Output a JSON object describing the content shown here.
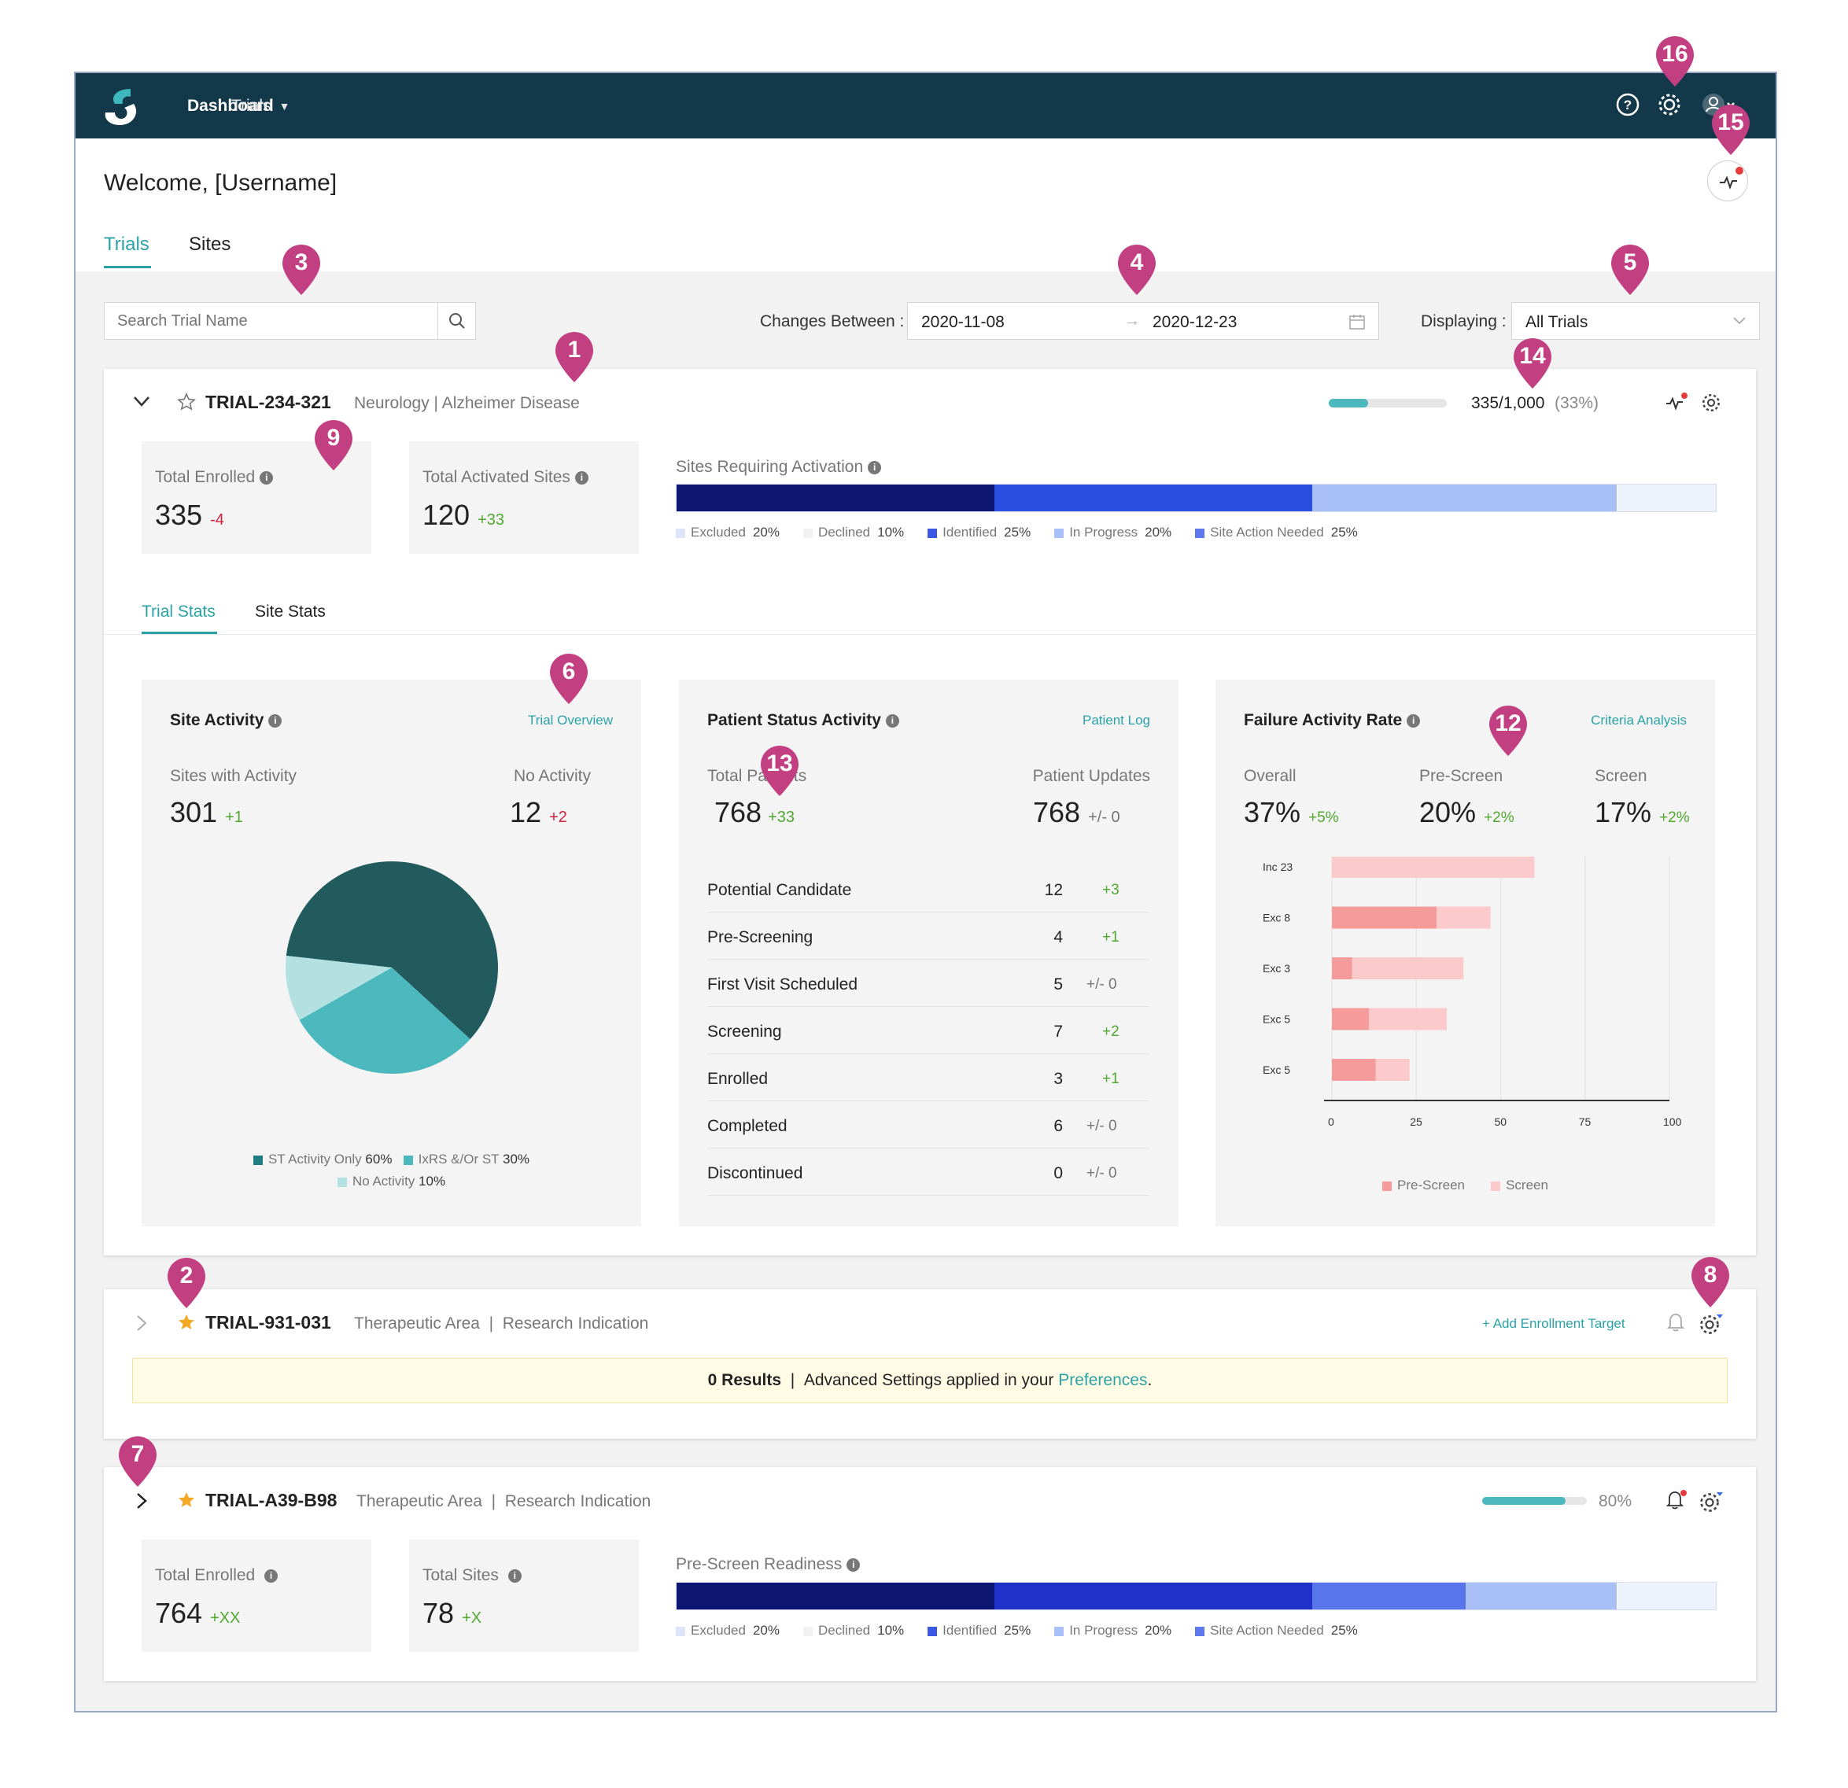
{
  "nav": {
    "dashboard": "Dashboard",
    "trials": "Trials"
  },
  "welcome": "Welcome, [Username]",
  "tabs": {
    "trials": "Trials",
    "sites": "Sites"
  },
  "filters": {
    "search_placeholder": "Search Trial Name",
    "changes_between": "Changes Between :",
    "date_from": "2020-11-08",
    "date_to": "2020-12-23",
    "displaying": "Displaying :",
    "display_value": "All Trials"
  },
  "trial1": {
    "id": "TRIAL-234-321",
    "area": "Neurology | Alzheimer Disease",
    "progress_text": "335/1,000",
    "progress_pct": "(33%)",
    "progress_fraction": 0.33,
    "total_enrolled_label": "Total Enrolled",
    "total_enrolled": "335",
    "total_enrolled_delta": "-4",
    "total_activated_label": "Total Activated Sites",
    "total_activated": "120",
    "total_activated_delta": "+33",
    "sites_req_label": "Sites Requiring Activation",
    "status_bar": [
      {
        "label": "Excluded",
        "pct": "20%",
        "color": "#0d1670",
        "value": 0.306
      },
      {
        "label": "Declined",
        "pct": "10%",
        "color": "#2b4fe0",
        "value": 0.306
      },
      {
        "label": "Identified",
        "pct": "25%",
        "color": "#a9c0f7",
        "value": 0.293
      },
      {
        "label": "In Progress",
        "pct": "20%",
        "color": "#eef2fd",
        "value": 0.095
      }
    ],
    "legend": [
      {
        "label": "Excluded",
        "pct": "20%",
        "color": "#dde4f7"
      },
      {
        "label": "Declined",
        "pct": "10%",
        "color": "#f1f1f1"
      },
      {
        "label": "Identified",
        "pct": "25%",
        "color": "#3a57e6"
      },
      {
        "label": "In Progress",
        "pct": "20%",
        "color": "#a9c0f7"
      },
      {
        "label": "Site Action Needed",
        "pct": "25%",
        "color": "#5f79ee"
      }
    ],
    "subtabs": {
      "trial_stats": "Trial Stats",
      "site_stats": "Site Stats"
    }
  },
  "site_activity": {
    "title": "Site Activity",
    "link": "Trial Overview",
    "with_label": "Sites with Activity",
    "with_value": "301",
    "with_delta": "+1",
    "no_label": "No Activity",
    "no_value": "12",
    "no_delta": "+2",
    "pie": [
      {
        "label": "ST Activity Only",
        "pct": "60%",
        "value": 60,
        "color": "#215b5e"
      },
      {
        "label": "IxRS &/Or ST",
        "pct": "30%",
        "value": 30,
        "color": "#4bb8bd"
      },
      {
        "label": "No Activity",
        "pct": "10%",
        "value": 10,
        "color": "#b3e1e2"
      }
    ]
  },
  "patient_status": {
    "title": "Patient Status Activity",
    "link": "Patient Log",
    "total_label": "Total Patients",
    "total_value": "768",
    "total_delta": "+33",
    "updates_label": "Patient Updates",
    "updates_value": "768",
    "updates_delta": "+/- 0",
    "rows": [
      {
        "label": "Potential Candidate",
        "value": "12",
        "delta": "+3"
      },
      {
        "label": "Pre-Screening",
        "value": "4",
        "delta": "+1"
      },
      {
        "label": "First Visit Scheduled",
        "value": "5",
        "delta": "+/- 0"
      },
      {
        "label": "Screening",
        "value": "7",
        "delta": "+2"
      },
      {
        "label": "Enrolled",
        "value": "3",
        "delta": "+1"
      },
      {
        "label": "Completed",
        "value": "6",
        "delta": "+/- 0"
      },
      {
        "label": "Discontinued",
        "value": "0",
        "delta": "+/- 0"
      }
    ]
  },
  "failure": {
    "title": "Failure Activity Rate",
    "link": "Criteria Analysis",
    "overall_label": "Overall",
    "overall_value": "37%",
    "overall_delta": "+5%",
    "prescreen_label": "Pre-Screen",
    "prescreen_value": "20%",
    "prescreen_delta": "+2%",
    "screen_label": "Screen",
    "screen_value": "17%",
    "screen_delta": "+2%"
  },
  "chart_data": {
    "type": "bar",
    "orientation": "horizontal",
    "stacked": true,
    "categories": [
      "Inc 23",
      "Exc 8",
      "Exc 3",
      "Exc 5",
      "Exc 5"
    ],
    "series": [
      {
        "name": "Pre-Screen",
        "values": [
          0,
          31,
          6,
          11,
          13
        ],
        "color": "#f59b9b"
      },
      {
        "name": "Screen",
        "values": [
          60,
          16,
          33,
          23,
          10
        ],
        "color": "#fccaca"
      }
    ],
    "xticks": [
      "0",
      "25",
      "50",
      "75",
      "100"
    ],
    "xlim": [
      0,
      100
    ],
    "grid": true,
    "legend_position": "bottom"
  },
  "trial2": {
    "id": "TRIAL-931-031",
    "area": "Therapeutic Area",
    "indication": "Research Indication",
    "add_target": "+ Add Enrollment Target",
    "results": "0 Results",
    "notice": "Advanced Settings applied in your",
    "preferences": "Preferences",
    "period": "."
  },
  "trial3": {
    "id": "TRIAL-A39-B98",
    "area": "Therapeutic Area",
    "indication": "Research Indication",
    "progress_pct": "80%",
    "progress_fraction": 0.8,
    "total_enrolled_label": "Total Enrolled",
    "total_enrolled": "764",
    "total_enrolled_delta": "+XX",
    "total_sites_label": "Total Sites",
    "total_sites": "78",
    "total_sites_delta": "+X",
    "readiness_label": "Pre-Screen Readiness",
    "status_bar": [
      {
        "color": "#0d1670",
        "value": 0.306
      },
      {
        "color": "#2031c9",
        "value": 0.306
      },
      {
        "color": "#5875ec",
        "value": 0.147
      },
      {
        "color": "#a9c0f7",
        "value": 0.146
      },
      {
        "color": "#eef2fd",
        "value": 0.095
      }
    ]
  },
  "callouts": [
    "1",
    "2",
    "3",
    "4",
    "5",
    "6",
    "7",
    "8",
    "9",
    "12",
    "13",
    "14",
    "15",
    "16"
  ],
  "colors": {
    "accent": "#2aa2a6",
    "nav": "#12384a",
    "pin": "#c23f82"
  }
}
